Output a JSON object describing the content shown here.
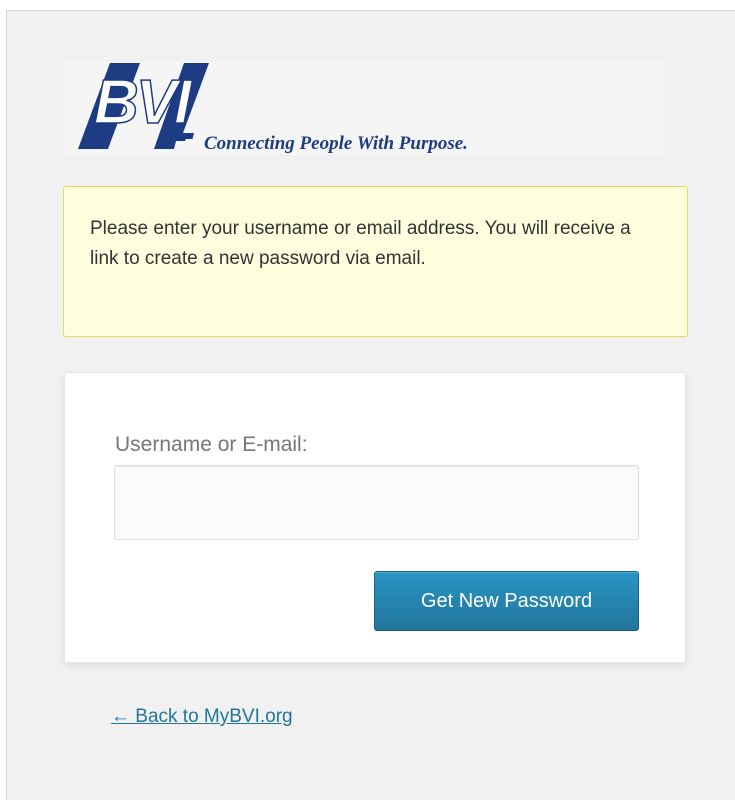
{
  "logo": {
    "wordmark": "BVI",
    "tagline": "Connecting People With Purpose.",
    "brand_color": "#1d3c83"
  },
  "message": {
    "text": "Please enter your username or email address. You will receive a link to create a new password via email."
  },
  "form": {
    "username_label": "Username or E-mail:",
    "username_value": "",
    "username_placeholder": "",
    "submit_label": "Get New Password"
  },
  "footer": {
    "back_link": "← Back to MyBVI.org"
  },
  "colors": {
    "accent": "#21759b",
    "notice_bg": "#ffffe0",
    "notice_border": "#e6db55"
  }
}
